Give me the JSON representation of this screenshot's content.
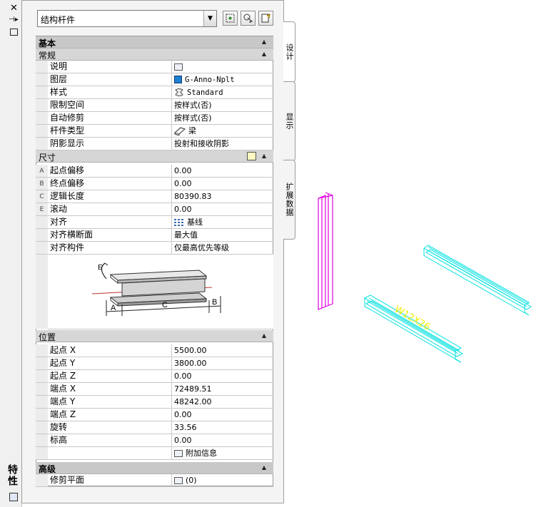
{
  "palette": {
    "vertical_title": "特性",
    "combo_value": "结构杆件"
  },
  "tabs": [
    {
      "label": "设计"
    },
    {
      "label": "显示"
    },
    {
      "label": "扩展数据"
    }
  ],
  "sections": {
    "basic": "基本",
    "general": "常规",
    "dimensions": "尺寸",
    "location": "位置",
    "advanced": "高级"
  },
  "general_rows": [
    {
      "label": "说明",
      "value": ""
    },
    {
      "label": "图层",
      "value": "G-Anno-Nplt"
    },
    {
      "label": "样式",
      "value": "Standard"
    },
    {
      "label": "限制空间",
      "value": "按样式(否)"
    },
    {
      "label": "自动修剪",
      "value": "按样式(否)"
    },
    {
      "label": "杆件类型",
      "value": "梁"
    },
    {
      "label": "阴影显示",
      "value": "投射和接收阴影"
    }
  ],
  "dimension_rows": [
    {
      "key": "A",
      "label": "起点偏移",
      "value": "0.00"
    },
    {
      "key": "B",
      "label": "终点偏移",
      "value": "0.00"
    },
    {
      "key": "C",
      "label": "逻辑长度",
      "value": "80390.83"
    },
    {
      "key": "E",
      "label": "滚动",
      "value": "0.00"
    },
    {
      "key": "",
      "label": "对齐",
      "value": "基线"
    },
    {
      "key": "",
      "label": "对齐横断面",
      "value": "最大值"
    },
    {
      "key": "",
      "label": "对齐构件",
      "value": "仅最高优先等级"
    }
  ],
  "diagram_labels": {
    "a": "A",
    "b": "B",
    "c": "C",
    "e": "E"
  },
  "location_rows": [
    {
      "label": "起点 X",
      "value": "5500.00"
    },
    {
      "label": "起点 Y",
      "value": "3800.00"
    },
    {
      "label": "起点 Z",
      "value": "0.00"
    },
    {
      "label": "端点 X",
      "value": "72489.51"
    },
    {
      "label": "端点 Y",
      "value": "48242.00"
    },
    {
      "label": "端点 Z",
      "value": "0.00"
    },
    {
      "label": "旋转",
      "value": "33.56"
    },
    {
      "label": "标高",
      "value": "0.00"
    },
    {
      "label": "",
      "value": "附加信息"
    }
  ],
  "advanced_rows": [
    {
      "label": "修剪平面",
      "value": "(0)"
    }
  ],
  "canvas": {
    "beam_label": "W12X26",
    "colors": {
      "magenta": "#e000e0",
      "cyan": "#00e0e0",
      "yellow": "#f0f000"
    }
  }
}
